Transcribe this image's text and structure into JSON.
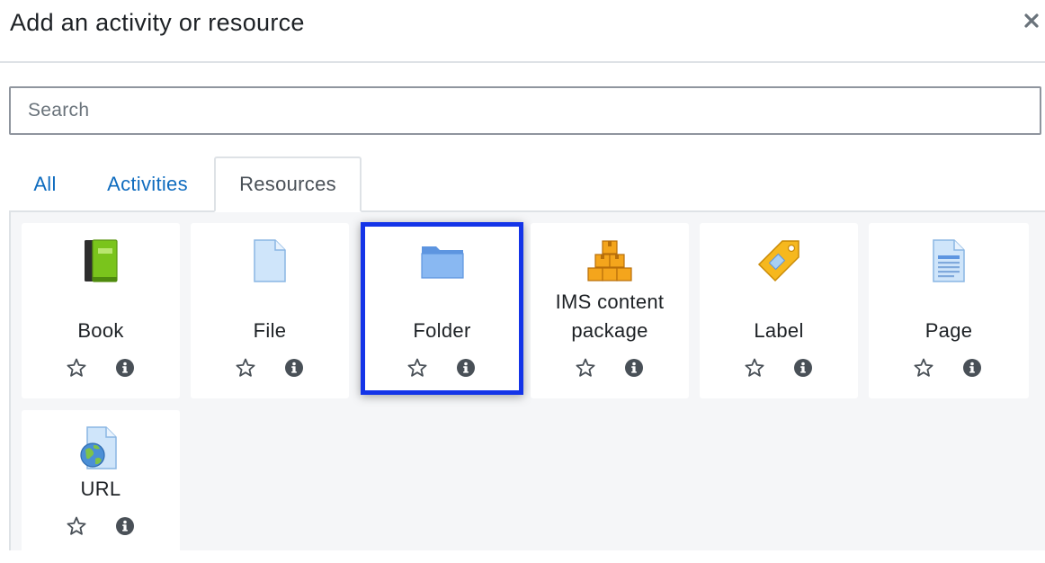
{
  "dialog": {
    "title": "Add an activity or resource",
    "close_label": "×"
  },
  "search": {
    "placeholder": "Search",
    "value": ""
  },
  "tabs": [
    {
      "label": "All",
      "active": false
    },
    {
      "label": "Activities",
      "active": false
    },
    {
      "label": "Resources",
      "active": true
    }
  ],
  "modules": [
    {
      "name": "Book",
      "icon": "book-icon"
    },
    {
      "name": "File",
      "icon": "file-icon"
    },
    {
      "name": "Folder",
      "icon": "folder-icon",
      "selected": true
    },
    {
      "name": "IMS content package",
      "icon": "ims-package-icon"
    },
    {
      "name": "Label",
      "icon": "label-tag-icon"
    },
    {
      "name": "Page",
      "icon": "page-icon"
    },
    {
      "name": "URL",
      "icon": "url-globe-icon"
    }
  ],
  "colors": {
    "accent_link": "#0f6cbf",
    "selection_border": "#1434e8",
    "panel_background": "#f5f6f8"
  }
}
